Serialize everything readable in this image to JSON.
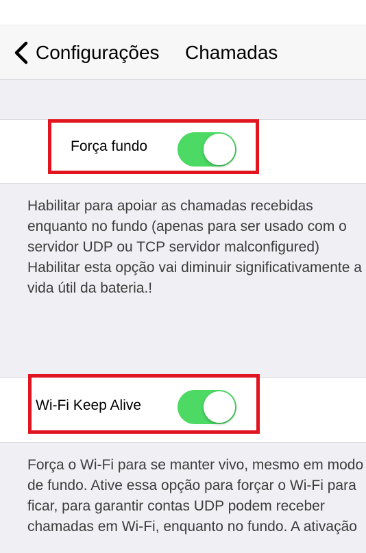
{
  "nav": {
    "back_label": "Configurações",
    "title": "Chamadas"
  },
  "settings": [
    {
      "label": "Força fundo",
      "enabled": true,
      "footer": "Habilitar para apoiar as chamadas recebidas enquanto no fundo (apenas para ser usado com o servidor UDP ou TCP servidor malconfigured) Habilitar esta opção vai diminuir significativamente a vida útil da bateria.!"
    },
    {
      "label": "Wi-Fi Keep Alive",
      "enabled": true,
      "footer": "Força o Wi-Fi para se manter vivo, mesmo em modo de fundo. Ative essa opção para forçar o Wi-Fi para ficar, para garantir contas UDP podem receber chamadas em Wi-Fi, enquanto no fundo. A ativação"
    }
  ],
  "colors": {
    "toggle_on": "#4cd964",
    "highlight": "#e0151f",
    "background": "#efeff4"
  }
}
